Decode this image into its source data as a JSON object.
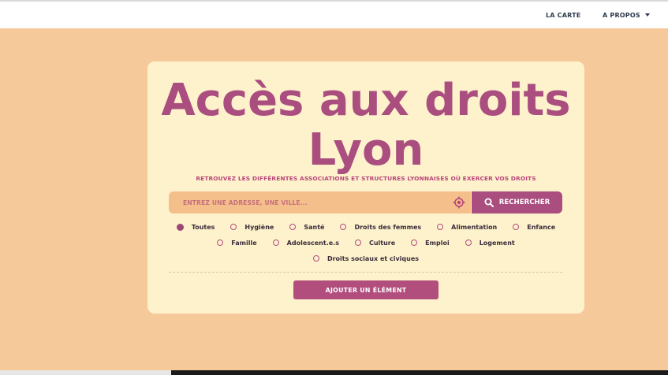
{
  "nav": {
    "map_label": "LA CARTE",
    "about_label": "A PROPOS"
  },
  "hero": {
    "title_line1": "Accès aux droits",
    "title_line2": "Lyon",
    "subtitle": "RETROUVEZ LES DIFFÉRENTES ASSOCIATIONS ET STRUCTURES LYONNAISES OÙ EXERCER VOS DROITS"
  },
  "search": {
    "placeholder": "ENTREZ UNE ADRESSE, UNE VILLE...",
    "value": "",
    "button_label": "RECHERCHER",
    "locate_icon": "crosshair-icon",
    "search_icon": "magnifier-icon"
  },
  "filters": {
    "rows": [
      [
        "Toutes",
        "Hygiène",
        "Santé",
        "Droits des femmes",
        "Alimentation",
        "Enfance"
      ],
      [
        "Famille",
        "Adolescent.e.s",
        "Culture",
        "Emploi",
        "Logement"
      ],
      [
        "Droits sociaux et civiques"
      ]
    ],
    "selected": "Toutes"
  },
  "actions": {
    "add_label": "AJOUTER UN ÉLÉMENT"
  },
  "colors": {
    "background": "#f6c99b",
    "card": "#fef2cc",
    "accent": "#a94e7f",
    "search_field": "#f5bf8c"
  }
}
